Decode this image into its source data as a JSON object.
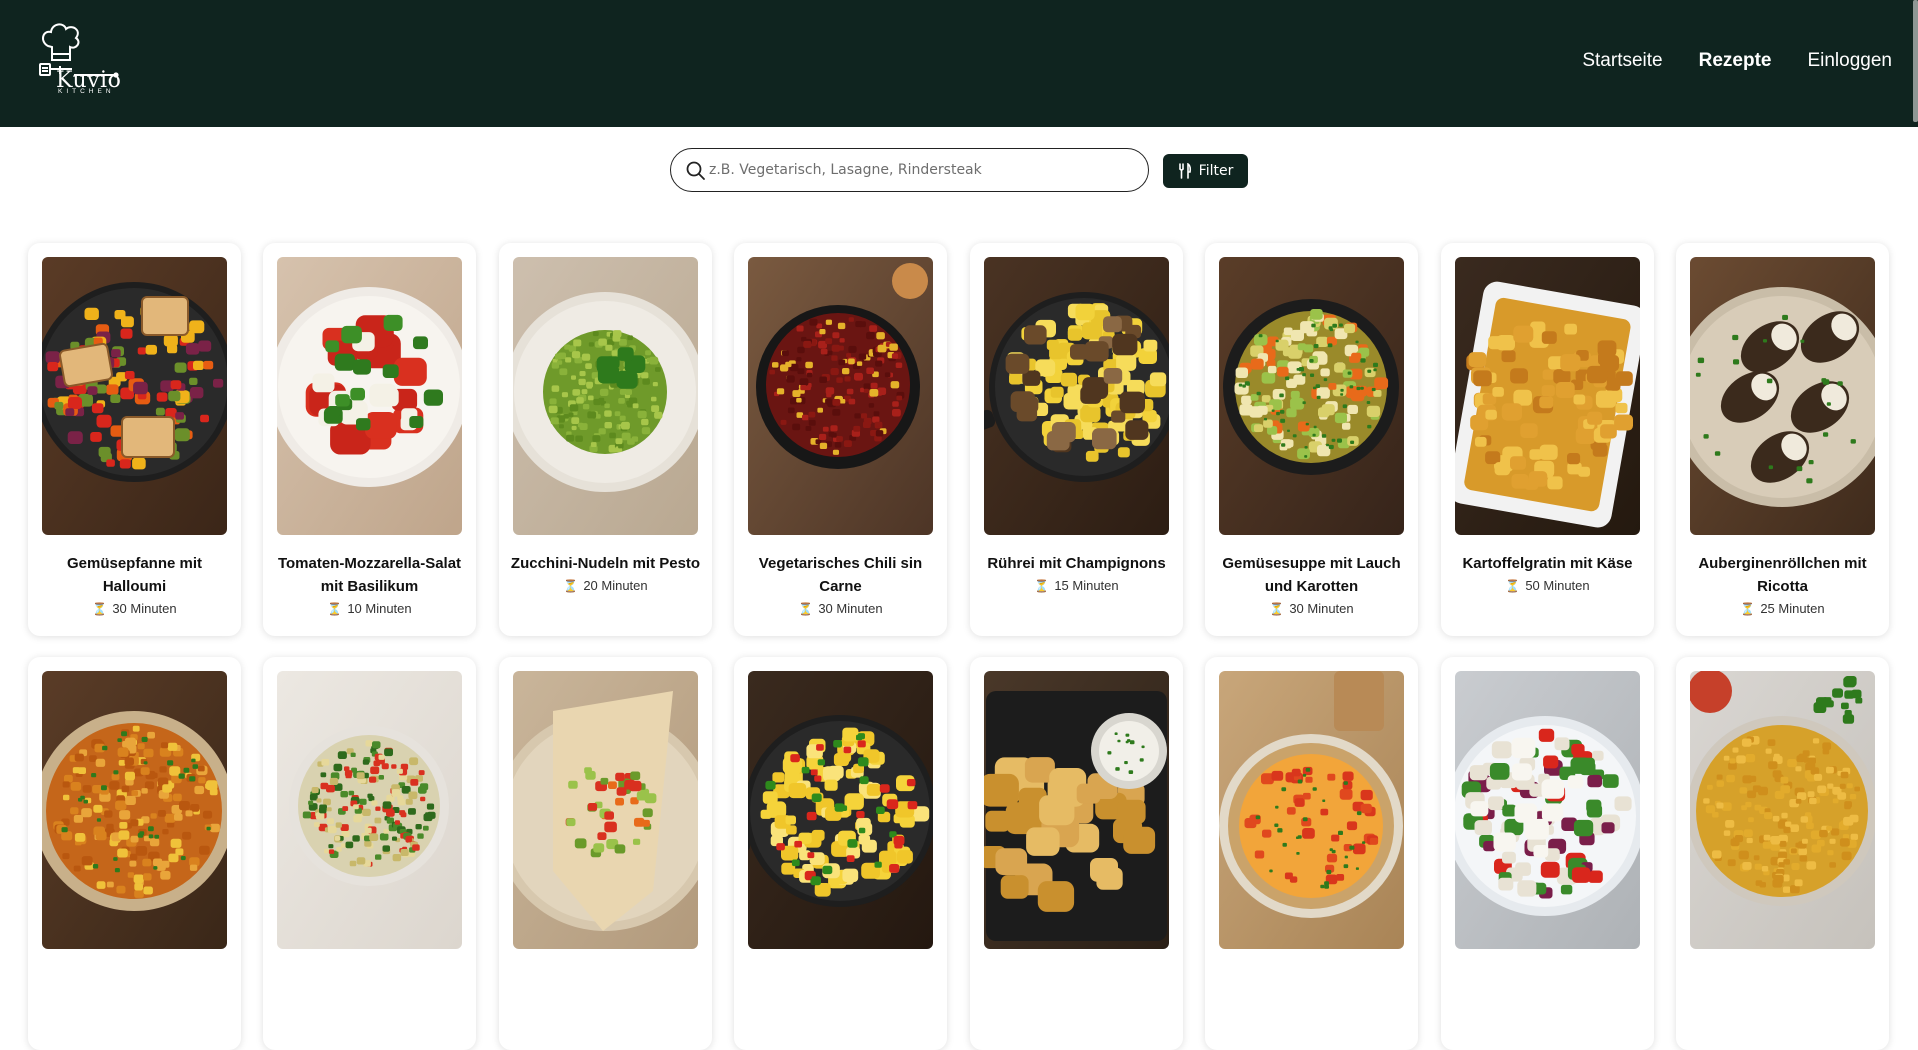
{
  "brand": {
    "name": "Kuvio",
    "sub": "KITCHEN"
  },
  "nav": [
    {
      "label": "Startseite",
      "active": false
    },
    {
      "label": "Rezepte",
      "active": true
    },
    {
      "label": "Einloggen",
      "active": false
    }
  ],
  "search": {
    "placeholder": "z.B. Vegetarisch, Lasagne, Rindersteak",
    "value": ""
  },
  "filter": {
    "label": "Filter"
  },
  "colors": {
    "header": "#0f241f",
    "accent": "#0f241f"
  },
  "recipes": [
    {
      "title": "Gemüsepfanne mit Halloumi",
      "time": "30 Minuten",
      "dish": "pan-halloumi"
    },
    {
      "title": "Tomaten-Mozzarella-Salat mit Basilikum",
      "time": "10 Minuten",
      "dish": "caprese"
    },
    {
      "title": "Zucchini-Nudeln mit Pesto",
      "time": "20 Minuten",
      "dish": "zoodles"
    },
    {
      "title": "Vegetarisches Chili sin Carne",
      "time": "30 Minuten",
      "dish": "chili"
    },
    {
      "title": "Rührei mit Champignons",
      "time": "15 Minuten",
      "dish": "eggs-mushrooms"
    },
    {
      "title": "Gemüsesuppe mit Lauch und Karotten",
      "time": "30 Minuten",
      "dish": "veg-soup"
    },
    {
      "title": "Kartoffelgratin mit Käse",
      "time": "50 Minuten",
      "dish": "gratin"
    },
    {
      "title": "Auberginenröllchen mit Ricotta",
      "time": "25 Minuten",
      "dish": "eggplant-rolls"
    },
    {
      "title": "",
      "time": "",
      "dish": "lentil-stew"
    },
    {
      "title": "",
      "time": "",
      "dish": "tabbouleh"
    },
    {
      "title": "",
      "time": "",
      "dish": "wrap"
    },
    {
      "title": "",
      "time": "",
      "dish": "scramble-peppers"
    },
    {
      "title": "",
      "time": "",
      "dish": "roast-potatoes"
    },
    {
      "title": "",
      "time": "",
      "dish": "frittata"
    },
    {
      "title": "",
      "time": "",
      "dish": "greek-salad"
    },
    {
      "title": "",
      "time": "",
      "dish": "dal"
    }
  ]
}
